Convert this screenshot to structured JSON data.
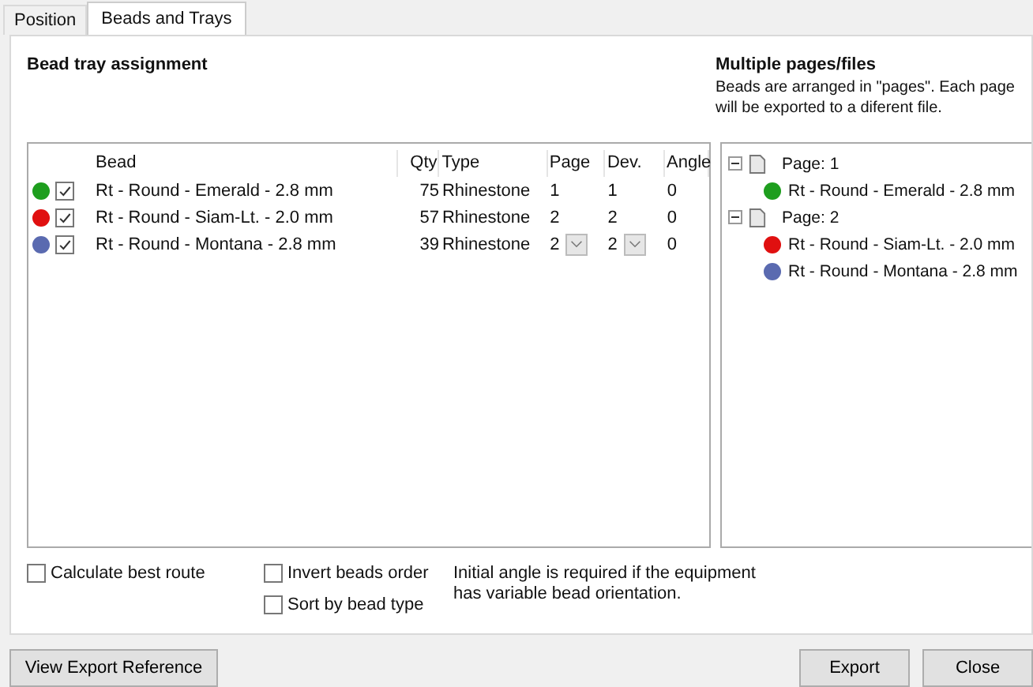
{
  "tabs": [
    {
      "label": "Position",
      "selected": false
    },
    {
      "label": "Beads and Trays",
      "selected": true
    }
  ],
  "assignment": {
    "title": "Bead tray assignment",
    "columns": [
      "Bead",
      "Qty",
      "Type",
      "Page",
      "Dev.",
      "Angle"
    ],
    "rows": [
      {
        "color": "#1e9e1e",
        "checked": true,
        "bead": "Rt - Round - Emerald - 2.8 mm",
        "qty": "75",
        "type": "Rhinestone",
        "page": "1",
        "dev": "1",
        "angle": "0",
        "editing": false
      },
      {
        "color": "#e01010",
        "checked": true,
        "bead": "Rt - Round - Siam-Lt. - 2.0 mm",
        "qty": "57",
        "type": "Rhinestone",
        "page": "2",
        "dev": "2",
        "angle": "0",
        "editing": false
      },
      {
        "color": "#5a6ab0",
        "checked": true,
        "bead": "Rt - Round - Montana - 2.8 mm",
        "qty": "39",
        "type": "Rhinestone",
        "page": "2",
        "dev": "2",
        "angle": "0",
        "editing": true
      }
    ]
  },
  "pages": {
    "title": "Multiple pages/files",
    "description": "Beads are arranged in \"pages\". Each page will be exported to a diferent file.",
    "tree": [
      {
        "label": "Page: 1",
        "expanded": true,
        "children": [
          {
            "label": "Rt - Round - Emerald - 2.8 mm",
            "color": "#1e9e1e"
          }
        ]
      },
      {
        "label": "Page: 2",
        "expanded": true,
        "children": [
          {
            "label": "Rt - Round - Siam-Lt. - 2.0 mm",
            "color": "#e01010"
          },
          {
            "label": "Rt - Round - Montana - 2.8 mm",
            "color": "#5a6ab0"
          }
        ]
      }
    ]
  },
  "options": [
    {
      "label": "Calculate best route",
      "checked": false
    },
    {
      "label": "Invert beads order",
      "checked": false
    },
    {
      "label": "Sort by bead type",
      "checked": false
    }
  ],
  "note": "Initial angle is required if the equipment has variable bead orientation.",
  "buttons": {
    "left": "View Export Reference",
    "right": [
      "Export",
      "Close"
    ]
  }
}
